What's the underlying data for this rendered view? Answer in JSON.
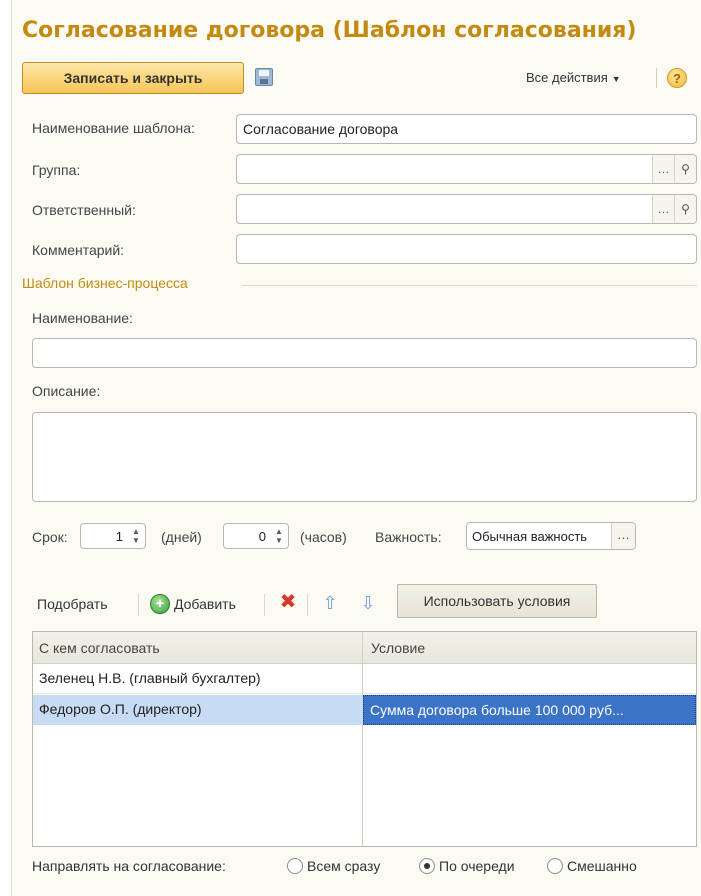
{
  "title": "Согласование договора (Шаблон согласования)",
  "toolbar": {
    "save_close": "Записать и закрыть",
    "all_actions": "Все действия",
    "help": "?"
  },
  "fields": {
    "template_name_label": "Наименование шаблона:",
    "template_name_value": "Согласование договора",
    "group_label": "Группа:",
    "group_value": "",
    "responsible_label": "Ответственный:",
    "responsible_value": "",
    "comment_label": "Комментарий:",
    "comment_value": ""
  },
  "bp_section": {
    "title": "Шаблон бизнес-процесса",
    "name_label": "Наименование:",
    "name_value": "",
    "description_label": "Описание:",
    "description_value": ""
  },
  "term": {
    "label": "Срок:",
    "days_value": "1",
    "days_unit": "(дней)",
    "hours_value": "0",
    "hours_unit": "(часов)",
    "importance_label": "Важность:",
    "importance_value": "Обычная важность"
  },
  "table_toolbar": {
    "pick": "Подобрать",
    "add": "Добавить",
    "use_conditions": "Использовать условия"
  },
  "table": {
    "headers": [
      "С кем согласовать",
      "Условие"
    ],
    "rows": [
      {
        "who": "Зеленец Н.В. (главный бухгалтер)",
        "condition": ""
      },
      {
        "who": "Федоров О.П. (директор)",
        "condition": "Сумма договора больше 100 000 руб..."
      }
    ]
  },
  "routing": {
    "label": "Направлять на согласование:",
    "options": [
      "Всем сразу",
      "По очереди",
      "Смешанно"
    ],
    "selected": "По очереди"
  },
  "colors": {
    "accent": "#c38a12",
    "primary_button": "#f6c556",
    "selection": "#3b73c6"
  }
}
